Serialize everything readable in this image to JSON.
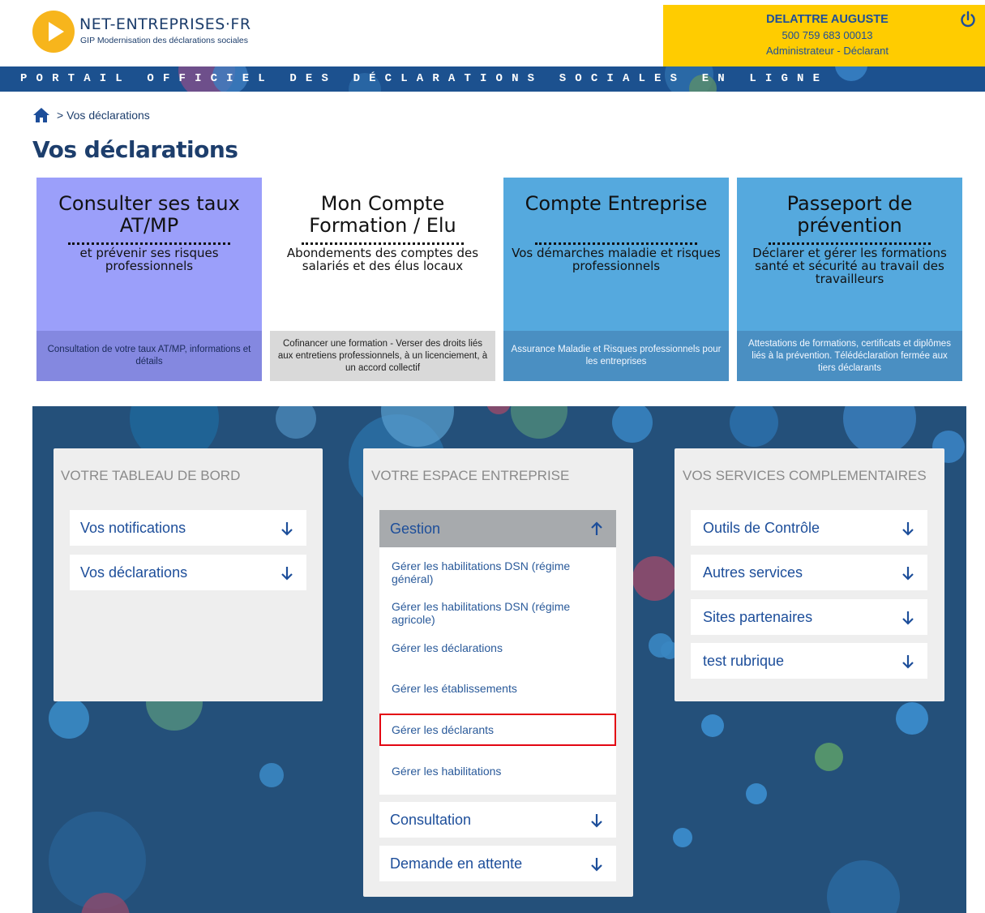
{
  "header": {
    "brand_name": "NET-ENTREPRISES·FR",
    "brand_sub": "GIP Modernisation des déclarations sociales",
    "user_name": "DELATTRE AUGUSTE",
    "user_siret": "500 759 683 00013",
    "user_role": "Administrateur - Déclarant",
    "banner": "PORTAIL OFFICIEL DES DÉCLARATIONS SOCIALES EN LIGNE"
  },
  "breadcrumb": {
    "separator": ">",
    "current": "Vos déclarations"
  },
  "page_title": "Vos déclarations",
  "tiles": [
    {
      "title": "Consulter ses taux AT/MP",
      "subtitle": "et prévenir ses risques professionnels",
      "footer": "Consultation de votre taux AT/MP, informations et détails",
      "color_top": "#9b9ffa",
      "color_bottom": "#8488e0"
    },
    {
      "title": "Mon Compte Formation / Elu",
      "subtitle": "Abondements des comptes des salariés et des élus locaux",
      "footer": "Cofinancer une formation - Verser des droits liés aux entretiens professionnels, à un licenciement, à un accord collectif",
      "color_top": "#ffffff",
      "color_bottom": "#d9d9d9"
    },
    {
      "title": "Compte Entreprise",
      "subtitle": "Vos démarches maladie et risques professionnels",
      "footer": "Assurance Maladie et Risques professionnels pour les entreprises",
      "color_top": "#55a9de",
      "color_bottom": "#4a8fc2"
    },
    {
      "title": "Passeport de prévention",
      "subtitle": "Déclarer et gérer les formations santé et sécurité au travail des travailleurs",
      "footer": "Attestations de formations, certificats et diplômes liés à la prévention. Télédéclaration fermée aux tiers déclarants",
      "color_top": "#55a9de",
      "color_bottom": "#4a8fc2"
    }
  ],
  "cards": {
    "dashboard": {
      "title": "VOTRE TABLEAU DE BORD",
      "items": [
        "Vos notifications",
        "Vos déclarations"
      ]
    },
    "espace": {
      "title": "VOTRE ESPACE ENTREPRISE",
      "open_item": "Gestion",
      "sub_items": [
        "Gérer les habilitations DSN (régime général)",
        "Gérer les habilitations DSN (régime agricole)",
        "Gérer les déclarations",
        "Gérer les établissements",
        "Gérer les déclarants",
        "Gérer les habilitations"
      ],
      "items": [
        "Consultation",
        "Demande en attente"
      ]
    },
    "services": {
      "title": "VOS SERVICES COMPLEMENTAIRES",
      "items": [
        "Outils de Contrôle",
        "Autres services",
        "Sites partenaires",
        "test rubrique"
      ]
    }
  },
  "icons": {
    "power": "power-icon",
    "home": "home-icon",
    "arrow_down": "arrow-down-icon",
    "arrow_up": "arrow-up-icon"
  },
  "colors": {
    "accent_yellow": "#ffcc00",
    "banner_blue": "#1c518f",
    "panel_blue": "#24507a",
    "link_blue": "#1d4e9a",
    "highlight_red": "#e30613"
  }
}
